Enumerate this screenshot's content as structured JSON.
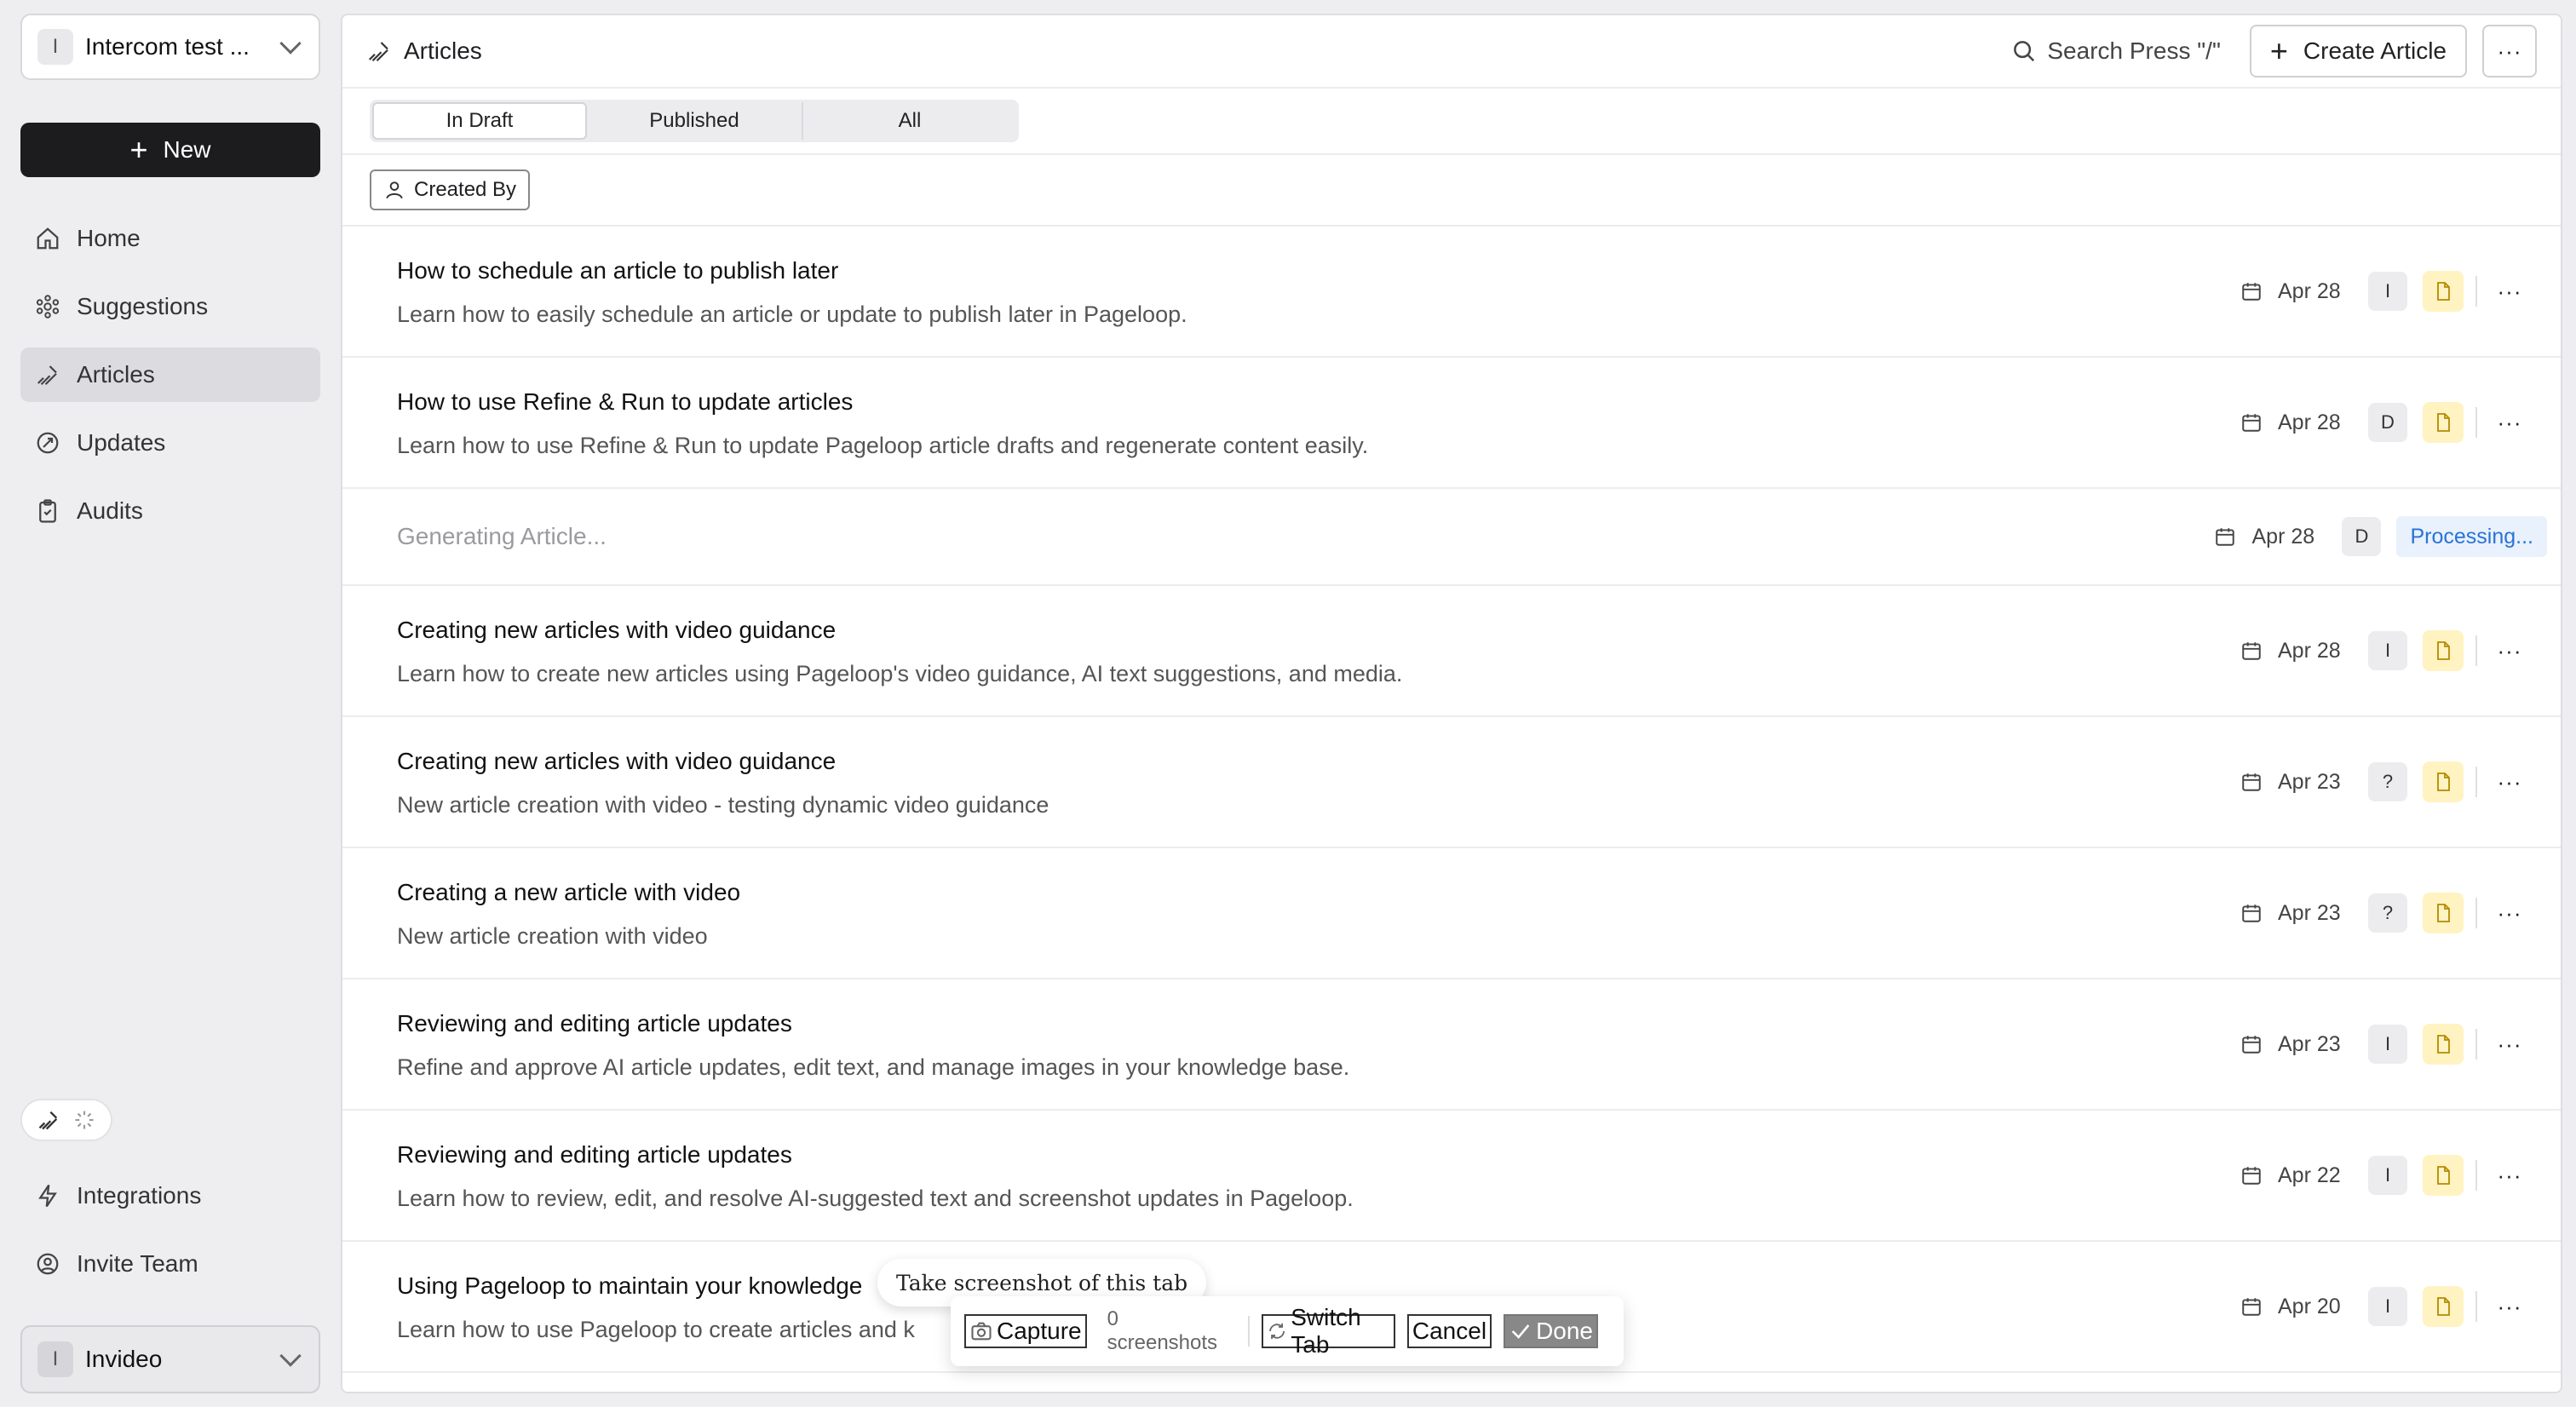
{
  "workspace": {
    "badge": "I",
    "name": "Intercom test ..."
  },
  "new_button": {
    "label": "New"
  },
  "nav": [
    {
      "label": "Home",
      "icon": "home-icon"
    },
    {
      "label": "Suggestions",
      "icon": "suggestions-icon"
    },
    {
      "label": "Articles",
      "icon": "articles-icon",
      "active": true
    },
    {
      "label": "Updates",
      "icon": "updates-icon"
    },
    {
      "label": "Audits",
      "icon": "audits-icon"
    }
  ],
  "nav_bottom": [
    {
      "label": "Integrations",
      "icon": "bolt-icon"
    },
    {
      "label": "Invite Team",
      "icon": "invite-icon"
    }
  ],
  "org": {
    "badge": "I",
    "name": "Invideo"
  },
  "header": {
    "title": "Articles",
    "search_label": "Search Press \"/\"",
    "create_label": "Create Article",
    "more_label": "···"
  },
  "tabs": [
    {
      "label": "In Draft",
      "active": true
    },
    {
      "label": "Published"
    },
    {
      "label": "All"
    }
  ],
  "filter": {
    "label": "Created By"
  },
  "articles": [
    {
      "title": "How to schedule an article to publish later",
      "desc": "Learn how to easily schedule an article or update to publish later in Pageloop.",
      "date": "Apr 28",
      "author": "I"
    },
    {
      "title": "How to use Refine & Run to update articles",
      "desc": "Learn how to use Refine & Run to update Pageloop article drafts and regenerate content easily.",
      "date": "Apr 28",
      "author": "D"
    },
    {
      "generating": "Generating Article...",
      "date": "Apr 28",
      "author": "D",
      "status": "Processing..."
    },
    {
      "title": "Creating new articles with video guidance",
      "desc": "Learn how to create new articles using Pageloop's video guidance, AI text suggestions, and media.",
      "date": "Apr 28",
      "author": "I"
    },
    {
      "title": "Creating new articles with video guidance",
      "desc": "New article creation with video - testing dynamic video guidance",
      "date": "Apr 23",
      "author": "?"
    },
    {
      "title": "Creating a new article with video",
      "desc": "New article creation with video",
      "date": "Apr 23",
      "author": "?"
    },
    {
      "title": "Reviewing and editing article updates",
      "desc": "Refine and approve AI article updates, edit text, and manage images in your knowledge base.",
      "date": "Apr 23",
      "author": "I"
    },
    {
      "title": "Reviewing and editing article updates",
      "desc": "Learn how to review, edit, and resolve AI-suggested text and screenshot updates in Pageloop.",
      "date": "Apr 22",
      "author": "I"
    },
    {
      "title": "Using Pageloop to maintain your knowledge",
      "desc": "Learn how to use Pageloop to create articles and k",
      "date": "Apr 20",
      "author": "I"
    }
  ],
  "row_more_label": "···",
  "capture": {
    "tooltip": "Take screenshot of this tab",
    "capture_label": "Capture",
    "count": "0 screenshots",
    "switch_label": "Switch Tab",
    "cancel_label": "Cancel",
    "done_label": "Done"
  }
}
